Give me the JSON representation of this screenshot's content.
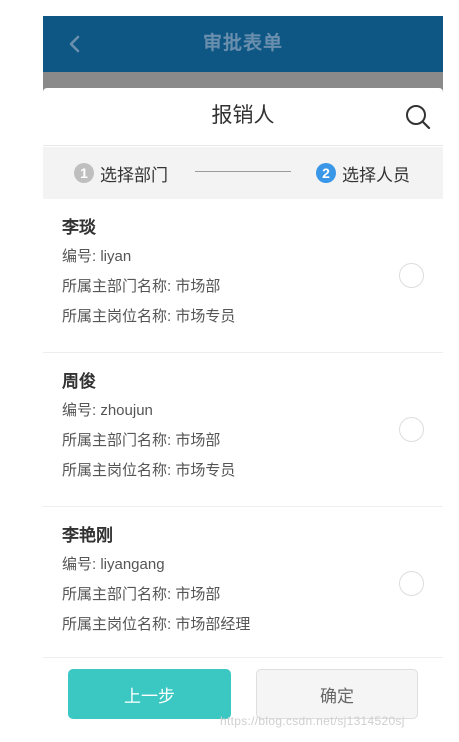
{
  "app_header": {
    "title": "审批表单"
  },
  "sheet": {
    "title": "报销人",
    "steps": [
      {
        "number": "1",
        "label": "选择部门"
      },
      {
        "number": "2",
        "label": "选择人员"
      }
    ]
  },
  "people": [
    {
      "name": "李琰",
      "id_line": "编号: liyan",
      "dept_line": "所属主部门名称: 市场部",
      "post_line": "所属主岗位名称: 市场专员"
    },
    {
      "name": "周俊",
      "id_line": "编号: zhoujun",
      "dept_line": "所属主部门名称: 市场部",
      "post_line": "所属主岗位名称: 市场专员"
    },
    {
      "name": "李艳刚",
      "id_line": "编号: liyangang",
      "dept_line": "所属主部门名称: 市场部",
      "post_line": "所属主岗位名称: 市场部经理"
    }
  ],
  "footer": {
    "prev_label": "上一步",
    "confirm_label": "确定"
  },
  "watermark": "https://blog.csdn.net/sj1314520sj",
  "colors": {
    "header": "#0e5784",
    "accent_teal": "#3cc8c2",
    "step_active": "#3a97e8"
  },
  "icons": {
    "back": "chevron-left-icon",
    "search": "search-icon"
  }
}
